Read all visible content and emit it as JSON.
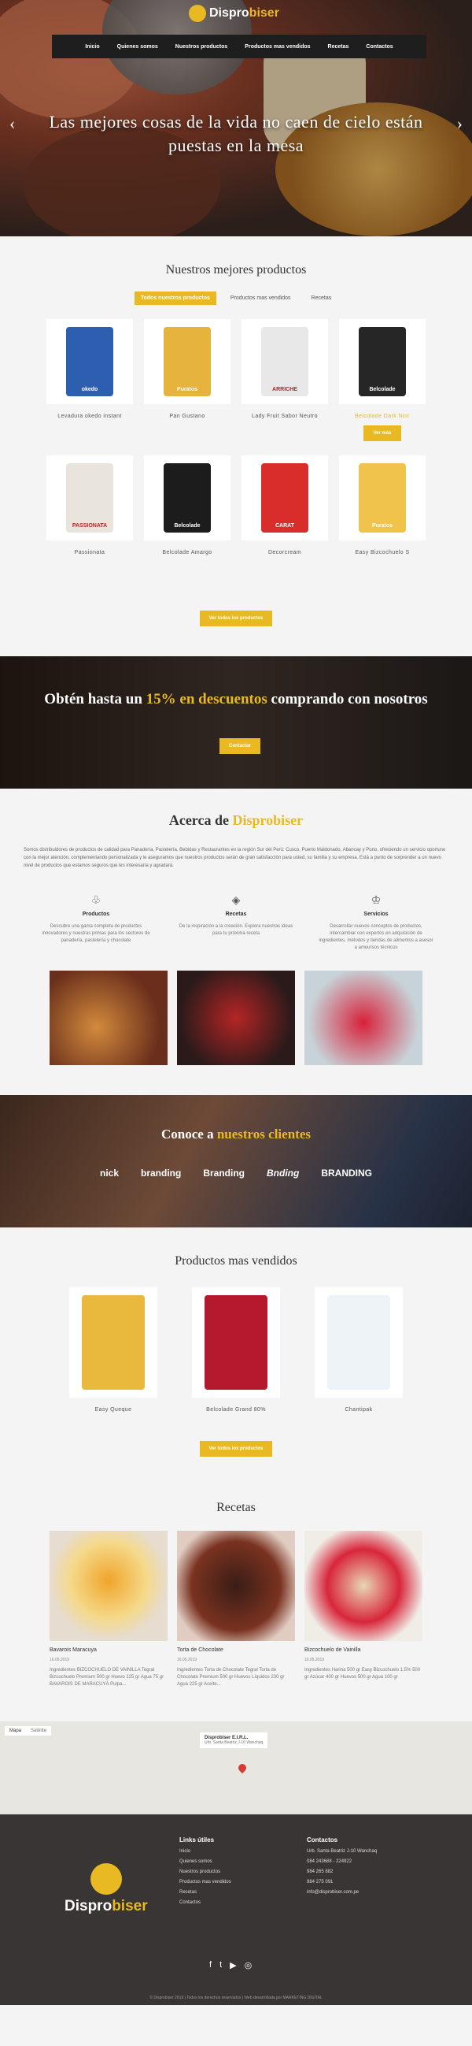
{
  "brand": {
    "name_pre": "Dispro",
    "name_post": "biser"
  },
  "nav": [
    "Inicio",
    "Quienes somos",
    "Nuestros productos",
    "Productos mas vendidos",
    "Recetas",
    "Contactos"
  ],
  "hero": {
    "title": "Las mejores cosas de la vida no caen de cielo están puestas en la mesa",
    "prev": "‹",
    "next": "›"
  },
  "products": {
    "title": "Nuestros mejores productos",
    "tabs": [
      "Todos nuestros productos",
      "Productos mas vendidos",
      "Recetas"
    ],
    "items": [
      {
        "name": "Levadura okedo instant",
        "color": "#2d5fb1",
        "label": "okedo"
      },
      {
        "name": "Pan Gustano",
        "color": "#e6b33d",
        "label": "Puratos"
      },
      {
        "name": "Lady Fruit Sabor Neutro",
        "color": "#e8e8e8",
        "label": "ARRICHE"
      },
      {
        "name": "Belcolade Dark Noir",
        "color": "#262626",
        "label": "Belcolade"
      },
      {
        "name": "Passionata",
        "color": "#e9e5dc",
        "label": "PASSIONATA"
      },
      {
        "name": "Belcolade Amargo",
        "color": "#1c1c1c",
        "label": "Belcolade"
      },
      {
        "name": "Decorcream",
        "color": "#d92d2b",
        "label": "CARAT"
      },
      {
        "name": "Easy Bizcochuelo S",
        "color": "#f0c34b",
        "label": "Puratos"
      }
    ],
    "view": "Ver más",
    "view_all": "Ver todos los productos"
  },
  "promo": {
    "pre": "Obtén hasta un ",
    "hl": "15% en descuentos",
    "post": " comprando con nosotros",
    "button": "Contactar"
  },
  "about": {
    "title_pre": "Acerca de ",
    "title_hl": "Disprobiser",
    "text": "Somos distribuidores de productos de calidad para Panadería, Pastelería, Bebidas y Restaurantes en la región Sur del Perú: Cusco, Puerto Maldonado, Abancay y Puno, ofreciendo un servicio oportuno con la mejor atención, complementando personalizada y le aseguramos que nuestros productos serán de gran satisfacción para usted, su familia y su empresa. Está a punto de sorprender a un nuevo nivel de productos que estamos seguros que les interesaría y agradará.",
    "features": [
      {
        "icon": "cupcake-icon",
        "title": "Productos",
        "text": "Descubre una gama completa de productos innovadores y nuestras primas para los sectores de panadería, pastelería y chocolate"
      },
      {
        "icon": "cake-icon",
        "title": "Recetas",
        "text": "De la inspiración a la creación. Explora nuestras ideas para tu próxima receta"
      },
      {
        "icon": "chef-icon",
        "title": "Servicios",
        "text": "Desarrollar nuevos conceptos de productos, intercambiar con expertos en adquisición de ingredientes, métodos y tiendas de alimentos a asesor a amoursos técnicos"
      }
    ]
  },
  "clients": {
    "pre": "Conoce a ",
    "hl": "nuestros clientes",
    "logos": [
      "nick",
      "branding",
      "Branding",
      "Bnding",
      "BRANDING"
    ]
  },
  "best": {
    "title": "Productos mas vendidos",
    "items": [
      {
        "name": "Easy Queque",
        "color": "#e8b93d"
      },
      {
        "name": "Belcolade Grand 80%",
        "color": "#b5192d"
      },
      {
        "name": "Chantipak",
        "color": "#eef3f8"
      }
    ],
    "button": "Ver todos los productos"
  },
  "recipes": {
    "title": "Recetas",
    "items": [
      {
        "title": "Bavarois Maracuya",
        "date": "16.05.2019",
        "text": "Ingredientes BIZCOCHUELO DE VAINILLA Tegral Bizcochuelo Premium 500 gr Huevo 125 gr Agua 75 gr BAVAROIS DE MARACUYÁ Pulpa..."
      },
      {
        "title": "Torta de Chocolate",
        "date": "16.05.2019",
        "text": "Ingredientes Torta de Chocolate Tegral Torta de Chocolate Premium 500 gr Huevos Líquidos 230 gr Agua 225 gr Aceite..."
      },
      {
        "title": "Bizcochuelo de Vainilla",
        "date": "16.05.2019",
        "text": "Ingredientes Harina 500 gr Easy Bizcochuelo 1.5% 500 gr Azúcar 400 gr Huevos 500 gr Agua 100 gr"
      }
    ]
  },
  "map": {
    "tabs": [
      "Mapa",
      "Satélite"
    ],
    "place": "Disprobiser E.I.R.L.",
    "address": "Urb. Santa Beatriz J-10 Wanchaq"
  },
  "footer": {
    "brand_pre": "Dispro",
    "brand_post": "biser",
    "links_title": "Links útiles",
    "links": [
      "Inicio",
      "Quienes somos",
      "Nuestros productos",
      "Productos mas vendidos",
      "Recetas",
      "Contactos"
    ],
    "contact_title": "Contactos",
    "contacts": [
      "Urb. Santa Beatriz J-10 Wanchaq",
      "084 243688 - 224922",
      "984 265 882",
      "984 275 091",
      "info@disprobiser.com.pe"
    ],
    "social": [
      "f",
      "t",
      "▶",
      "◎"
    ],
    "copy": "© Disprobiser 2019 | Todos los derechos reservados | Web desarrollada por MARKETING DIGITAL"
  }
}
